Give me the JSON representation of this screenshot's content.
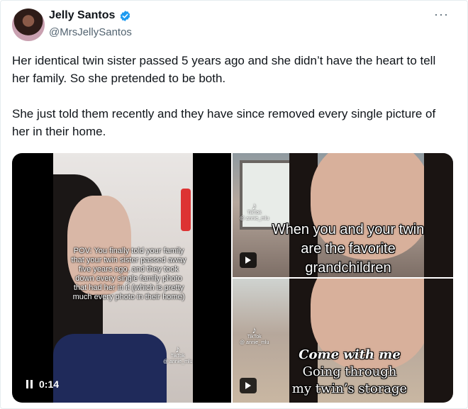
{
  "author": {
    "name": "Jelly Santos",
    "handle": "@MrsJellySantos",
    "verified_icon": "verified-badge-icon",
    "more_label": "···"
  },
  "tweet": {
    "paragraphs": [
      "Her identical twin sister passed 5 years ago and she didn’t have the heart to tell her family. So she pretended to be both.",
      "She just told them recently and they have since removed every single picture of her in their home."
    ]
  },
  "media": {
    "left": {
      "caption": "POV: You finally told your family that your twin sister passed away five years ago, and they took down every single family photo that had her in it (which is pretty much every photo in their home)",
      "tiktok_label": "TikTok",
      "tiktok_user": "@ annie_mlu",
      "time": "0:14",
      "control_icon": "pause-icon"
    },
    "top_right": {
      "caption_lines": [
        "When you and your twin",
        "are the favorite",
        "grandchildren"
      ],
      "tiktok_label": "TikTok",
      "tiktok_user": "@ annie_mlu",
      "control_icon": "play-icon"
    },
    "bottom_right": {
      "caption_lines": [
        "Come with me",
        "Going through",
        "my twin’s storage"
      ],
      "tiktok_label": "TikTok",
      "tiktok_user": "@ annie_mlu",
      "control_icon": "play-icon"
    }
  },
  "colors": {
    "text_primary": "#0f1419",
    "text_secondary": "#536471",
    "verified": "#1d9bf0"
  }
}
